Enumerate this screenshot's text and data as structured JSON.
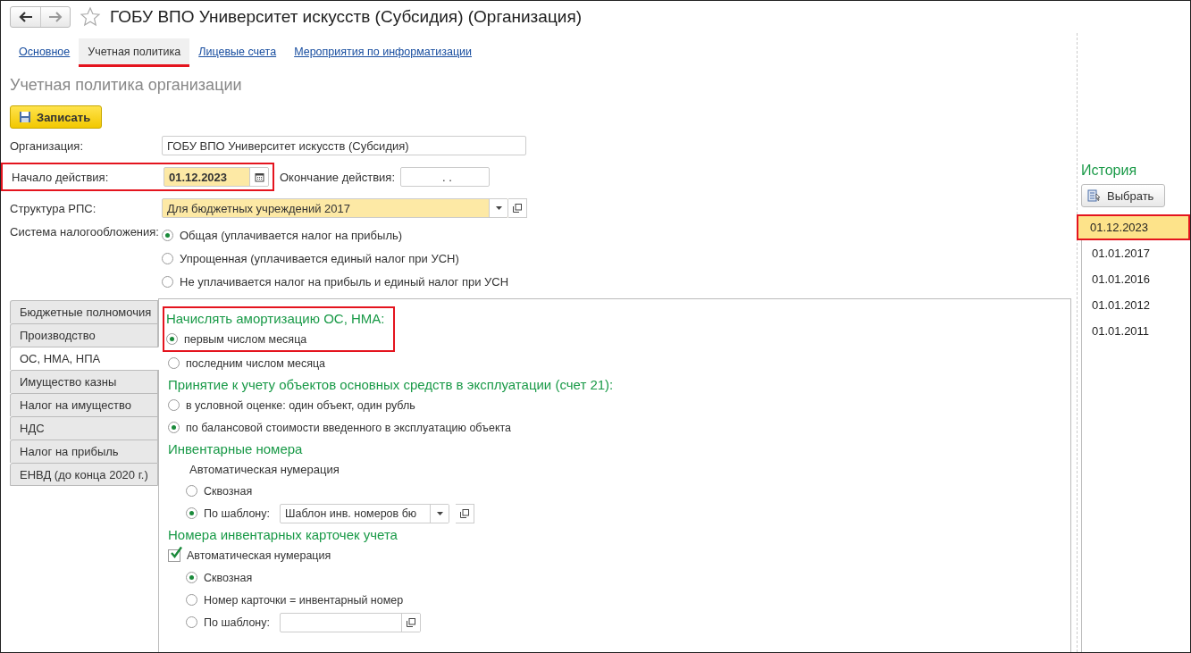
{
  "window": {
    "title": "ГОБУ ВПО Университет искусств (Субсидия) (Организация)",
    "favorite": false
  },
  "tabs": [
    {
      "label": "Основное",
      "selected": false
    },
    {
      "label": "Учетная политика",
      "selected": true
    },
    {
      "label": "Лицевые счета",
      "selected": false
    },
    {
      "label": "Мероприятия по информатизации",
      "selected": false
    }
  ],
  "form_title": "Учетная политика организации",
  "save_button": "Записать",
  "organization": {
    "label": "Организация:",
    "value": "ГОБУ ВПО Университет искусств (Субсидия)"
  },
  "start": {
    "label": "Начало действия:",
    "value": "01.12.2023",
    "highlighted": true
  },
  "end": {
    "label": "Окончание действия:",
    "value": ".  ."
  },
  "structure": {
    "label": "Структура РПС:",
    "value": "Для бюджетных учреждений 2017"
  },
  "tax_system": {
    "label": "Система налогообложения:",
    "options": [
      {
        "label": "Общая (уплачивается налог на прибыль)",
        "selected": true
      },
      {
        "label": "Упрощенная (уплачивается единый налог при УСН)",
        "selected": false
      },
      {
        "label": "Не уплачивается налог на прибыль и единый налог при УСН",
        "selected": false
      }
    ]
  },
  "side_tabs": [
    {
      "label": "Бюджетные полномочия",
      "selected": false
    },
    {
      "label": "Производство",
      "selected": false
    },
    {
      "label": "ОС, НМА, НПА",
      "selected": true
    },
    {
      "label": "Имущество казны",
      "selected": false
    },
    {
      "label": "Налог на имущество",
      "selected": false
    },
    {
      "label": "НДС",
      "selected": false
    },
    {
      "label": "Налог на прибыль",
      "selected": false
    },
    {
      "label": "ЕНВД (до конца 2020 г.)",
      "selected": false
    }
  ],
  "depreciation": {
    "title": "Начислять амортизацию ОС, НМА:",
    "highlighted": true,
    "options": [
      {
        "label": "первым числом месяца",
        "selected": true
      },
      {
        "label": "последним числом месяца",
        "selected": false
      }
    ]
  },
  "acceptance": {
    "title": "Принятие к учету объектов основных средств в эксплуатации (счет 21):",
    "options": [
      {
        "label": "в условной оценке: один объект, один рубль",
        "selected": false
      },
      {
        "label": "по балансовой стоимости введенного в эксплуатацию объекта",
        "selected": true
      }
    ]
  },
  "inventory_numbers": {
    "title": "Инвентарные номера",
    "subtitle": "Автоматическая нумерация",
    "options": [
      {
        "label": "Сквозная",
        "selected": false,
        "kind": "plain"
      },
      {
        "label": "По шаблону:",
        "selected": true,
        "kind": "template",
        "template": "Шаблон инв. номеров бю"
      }
    ]
  },
  "card_numbers": {
    "title": "Номера инвентарных карточек учета",
    "auto": {
      "label": "Автоматическая нумерация",
      "checked": true
    },
    "options": [
      {
        "label": "Сквозная",
        "selected": true,
        "kind": "plain"
      },
      {
        "label": "Номер карточки = инвентарный номер",
        "selected": false,
        "kind": "plain"
      },
      {
        "label": "По шаблону:",
        "selected": false,
        "kind": "template"
      }
    ]
  },
  "history": {
    "title": "История",
    "select_button": "Выбрать",
    "dates": [
      {
        "label": "01.12.2023",
        "selected": true,
        "highlighted": true
      },
      {
        "label": "01.01.2017",
        "selected": false,
        "highlighted": false
      },
      {
        "label": "01.01.2016",
        "selected": false,
        "highlighted": false
      },
      {
        "label": "01.01.2012",
        "selected": false,
        "highlighted": false
      },
      {
        "label": "01.01.2011",
        "selected": false,
        "highlighted": false
      }
    ]
  }
}
